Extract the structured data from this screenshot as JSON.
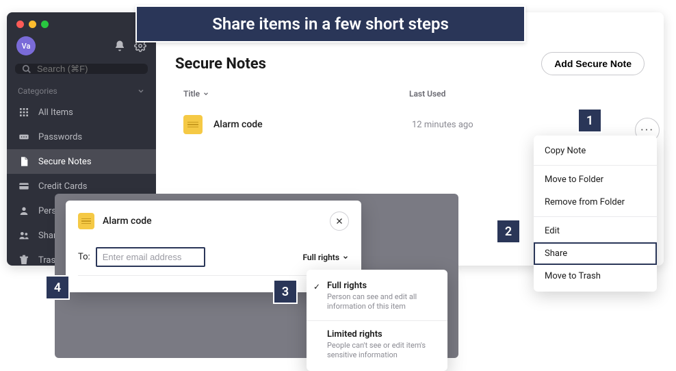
{
  "banner": "Share items in a few short steps",
  "avatar_initials": "Va",
  "search": {
    "placeholder": "Search (⌘F)"
  },
  "categories_label": "Categories",
  "nav": [
    {
      "label": "All Items"
    },
    {
      "label": "Passwords"
    },
    {
      "label": "Secure Notes"
    },
    {
      "label": "Credit Cards"
    },
    {
      "label": "Personal Info"
    },
    {
      "label": "Shared"
    },
    {
      "label": "Trash"
    }
  ],
  "page": {
    "title": "Secure Notes",
    "add_label": "Add Secure Note",
    "col_title": "Title",
    "col_last": "Last Used"
  },
  "row": {
    "title": "Alarm code",
    "last": "12 minutes ago"
  },
  "more_label": "···",
  "context": {
    "copy": "Copy Note",
    "move": "Move to Folder",
    "remove": "Remove from Folder",
    "edit": "Edit",
    "share": "Share",
    "trash": "Move to Trash"
  },
  "dialog": {
    "title": "Alarm code",
    "to_label": "To:",
    "email_placeholder": "Enter email address",
    "rights_selected": "Full rights"
  },
  "rights_dd": {
    "full": {
      "title": "Full rights",
      "desc": "Person can see and edit all information of this item"
    },
    "limited": {
      "title": "Limited rights",
      "desc": "People can't see or edit item's sensitive information"
    }
  },
  "steps": {
    "s1": "1",
    "s2": "2",
    "s3": "3",
    "s4": "4"
  }
}
